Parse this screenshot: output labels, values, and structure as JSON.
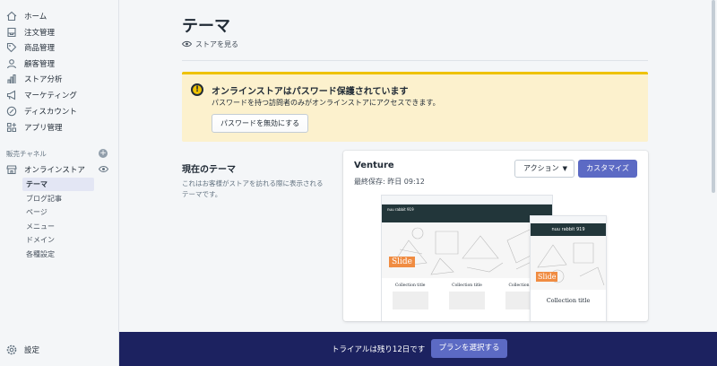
{
  "sidebar": {
    "items": [
      {
        "label": "ホーム",
        "icon": "home-icon"
      },
      {
        "label": "注文管理",
        "icon": "orders-icon"
      },
      {
        "label": "商品管理",
        "icon": "tag-icon"
      },
      {
        "label": "顧客管理",
        "icon": "person-icon"
      },
      {
        "label": "ストア分析",
        "icon": "bar-chart-icon"
      },
      {
        "label": "マーケティング",
        "icon": "megaphone-icon"
      },
      {
        "label": "ディスカウント",
        "icon": "discount-icon"
      },
      {
        "label": "アプリ管理",
        "icon": "apps-icon"
      }
    ],
    "sales_channels_label": "販売チャネル",
    "online_store_label": "オンラインストア",
    "sub_items": [
      "テーマ",
      "ブログ記事",
      "ページ",
      "メニュー",
      "ドメイン",
      "各種設定"
    ],
    "settings_label": "設定"
  },
  "main": {
    "title": "テーマ",
    "view_store": "ストアを見る",
    "banner": {
      "title": "オンラインストアはパスワード保護されています",
      "body": "パスワードを持つ訪問者のみがオンラインストアにアクセスできます。",
      "button": "パスワードを無効にする",
      "icon_symbol": "!"
    },
    "current_theme": {
      "title": "現在のテーマ",
      "description": "これはお客様がストアを訪れる際に表示されるテーマです。"
    },
    "theme_card": {
      "name": "Venture",
      "last_saved": "最終保存: 昨日 09:12",
      "action_button": "アクション",
      "customize_button": "カスタマイズ",
      "preview": {
        "store_name": "nuu rabbit 919",
        "slide_label": "Slide",
        "collection_title": "Collection title"
      }
    }
  },
  "trial": {
    "text": "トライアルは残り12日です",
    "button": "プランを選択する"
  },
  "colors": {
    "accent": "#5c6ac4",
    "banner_bg": "#fcf1cd",
    "banner_border": "#eec200",
    "trial_bar": "#1c2260",
    "preview_nav": "#22363a",
    "slide_orange": "#f08c42"
  }
}
